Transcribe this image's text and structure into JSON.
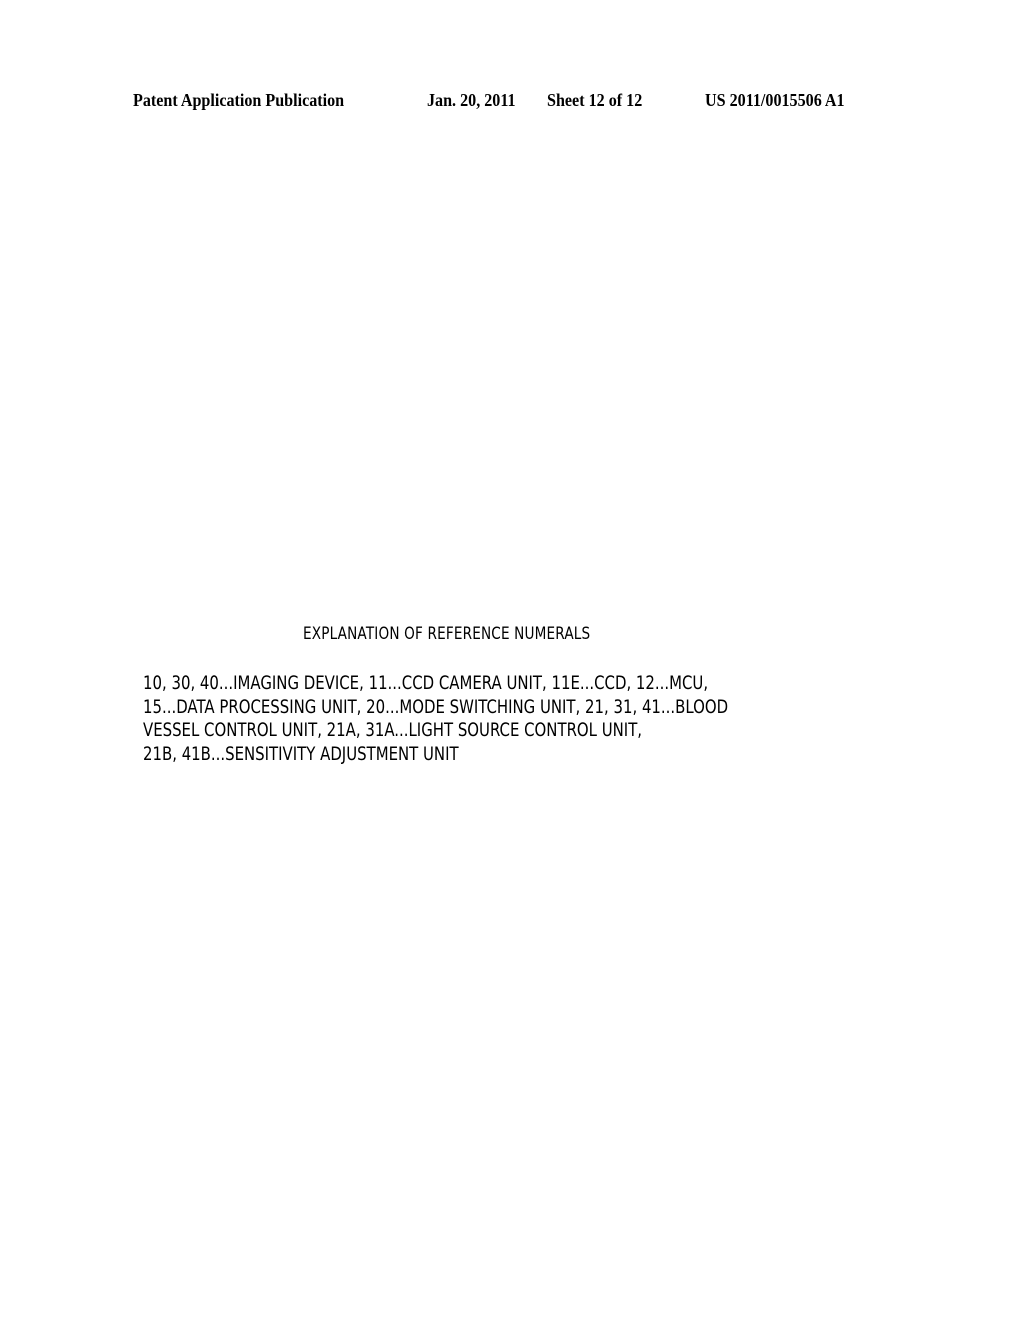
{
  "header": {
    "publication_type": "Patent Application Publication",
    "date": "Jan. 20, 2011",
    "sheet": "Sheet 12 of 12",
    "publication_number": "US 2011/0015506 A1"
  },
  "section": {
    "title": "EXPLANATION OF REFERENCE NUMERALS",
    "lines": [
      "10, 30, 40...IMAGING DEVICE, 11...CCD CAMERA UNIT, 11E...CCD, 12...MCU,",
      "15...DATA PROCESSING UNIT, 20...MODE SWITCHING UNIT, 21, 31, 41...BLOOD",
      "VESSEL CONTROL UNIT, 21A, 31A...LIGHT SOURCE CONTROL UNIT,",
      "21B, 41B...SENSITIVITY ADJUSTMENT UNIT"
    ]
  }
}
